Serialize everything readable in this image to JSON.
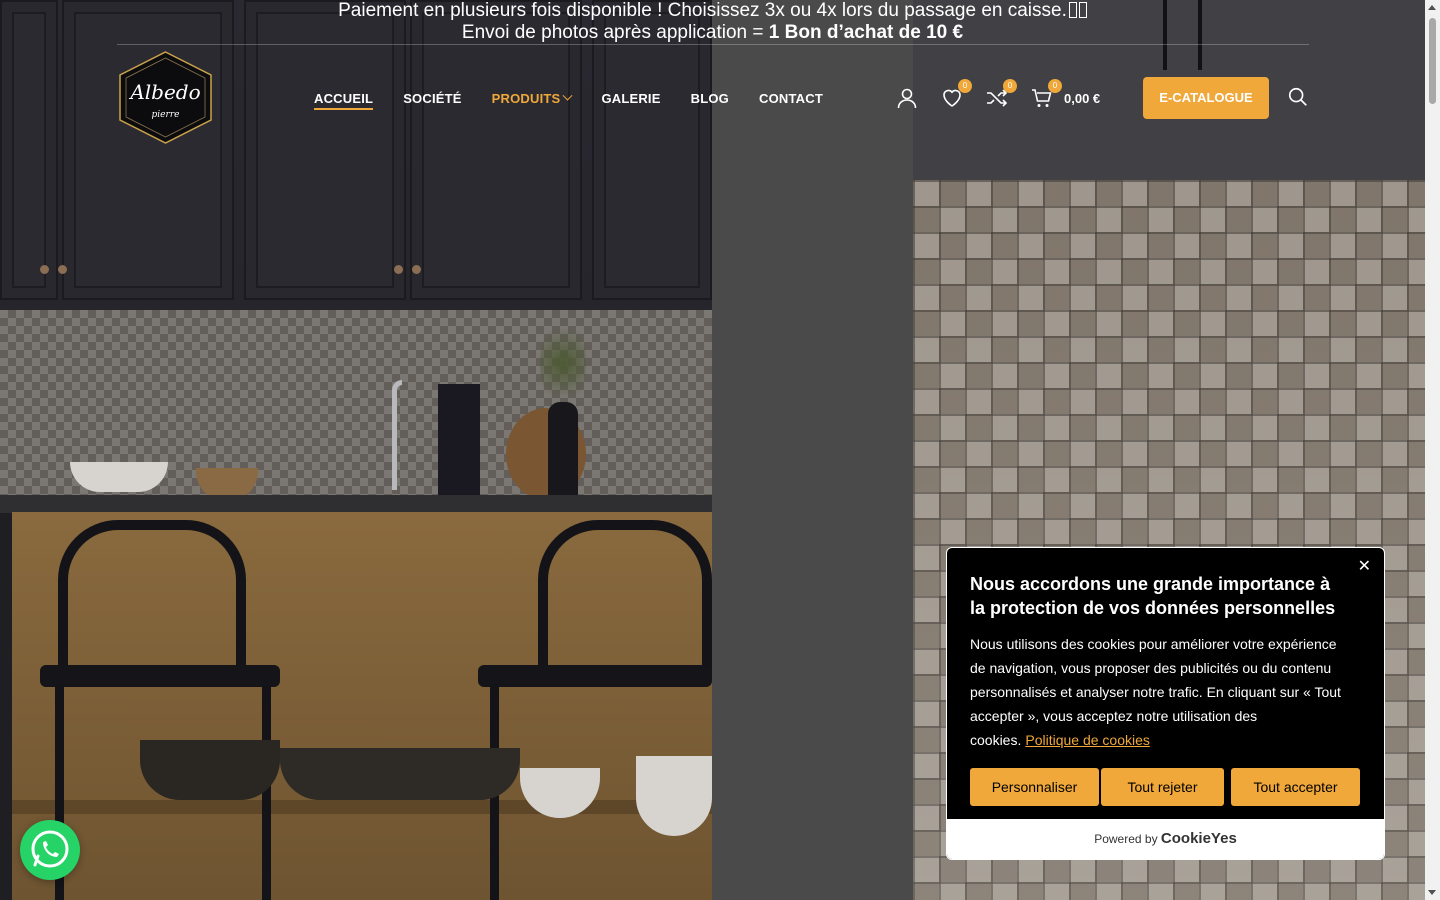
{
  "announcement": {
    "line1": "Paiement en plusieurs fois disponible ! Choisissez 3x ou 4x lors du passage en caisse.",
    "line2_prefix": "Envoi de photos après application = ",
    "line2_bold": "1 Bon d’achat de 10 €"
  },
  "logo": {
    "name": "Albedo",
    "tagline": "pierre"
  },
  "nav": {
    "items": [
      {
        "label": "ACCUEIL"
      },
      {
        "label": "SOCIÉTÉ"
      },
      {
        "label": "PRODUITS"
      },
      {
        "label": "GALERIE"
      },
      {
        "label": "BLOG"
      },
      {
        "label": "CONTACT"
      }
    ]
  },
  "header_icons": {
    "wishlist_count": "0",
    "compare_count": "0",
    "cart_count": "0",
    "cart_total": "0,00 €",
    "cta_label": "E-CATALOGUE"
  },
  "colors": {
    "accent": "#f0a83a",
    "whatsapp": "#25d366"
  },
  "cookie_banner": {
    "title": "Nous accordons une grande importance à la protection de vos données personnelles",
    "body": "Nous utilisons des cookies pour améliorer votre expérience de navigation, vous proposer des publicités ou du contenu personnalisés et analyser notre trafic. En cliquant sur « Tout accepter », vous acceptez notre utilisation des cookies.",
    "policy_link": "Politique de cookies",
    "btn_customize": "Personnaliser",
    "btn_reject": "Tout rejeter",
    "btn_accept": "Tout accepter",
    "powered_by": "Powered by",
    "powered_brand": "CookieYes",
    "close": "✕"
  }
}
